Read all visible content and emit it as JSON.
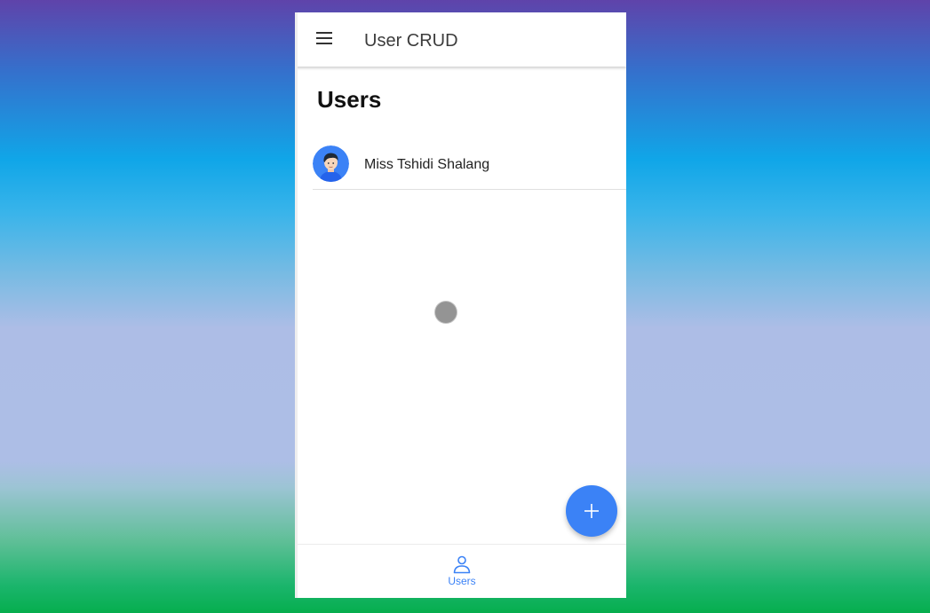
{
  "appbar": {
    "title": "User CRUD",
    "menu_icon": "menu-icon"
  },
  "page": {
    "title": "Users"
  },
  "users": [
    {
      "name": "Miss Tshidi Shalang",
      "avatar": "avatar-icon"
    }
  ],
  "fab": {
    "icon": "plus-icon"
  },
  "bottom_nav": {
    "items": [
      {
        "label": "Users",
        "icon": "person-icon",
        "active": true
      }
    ]
  },
  "colors": {
    "accent": "#3b82f6",
    "text": "#222222"
  }
}
